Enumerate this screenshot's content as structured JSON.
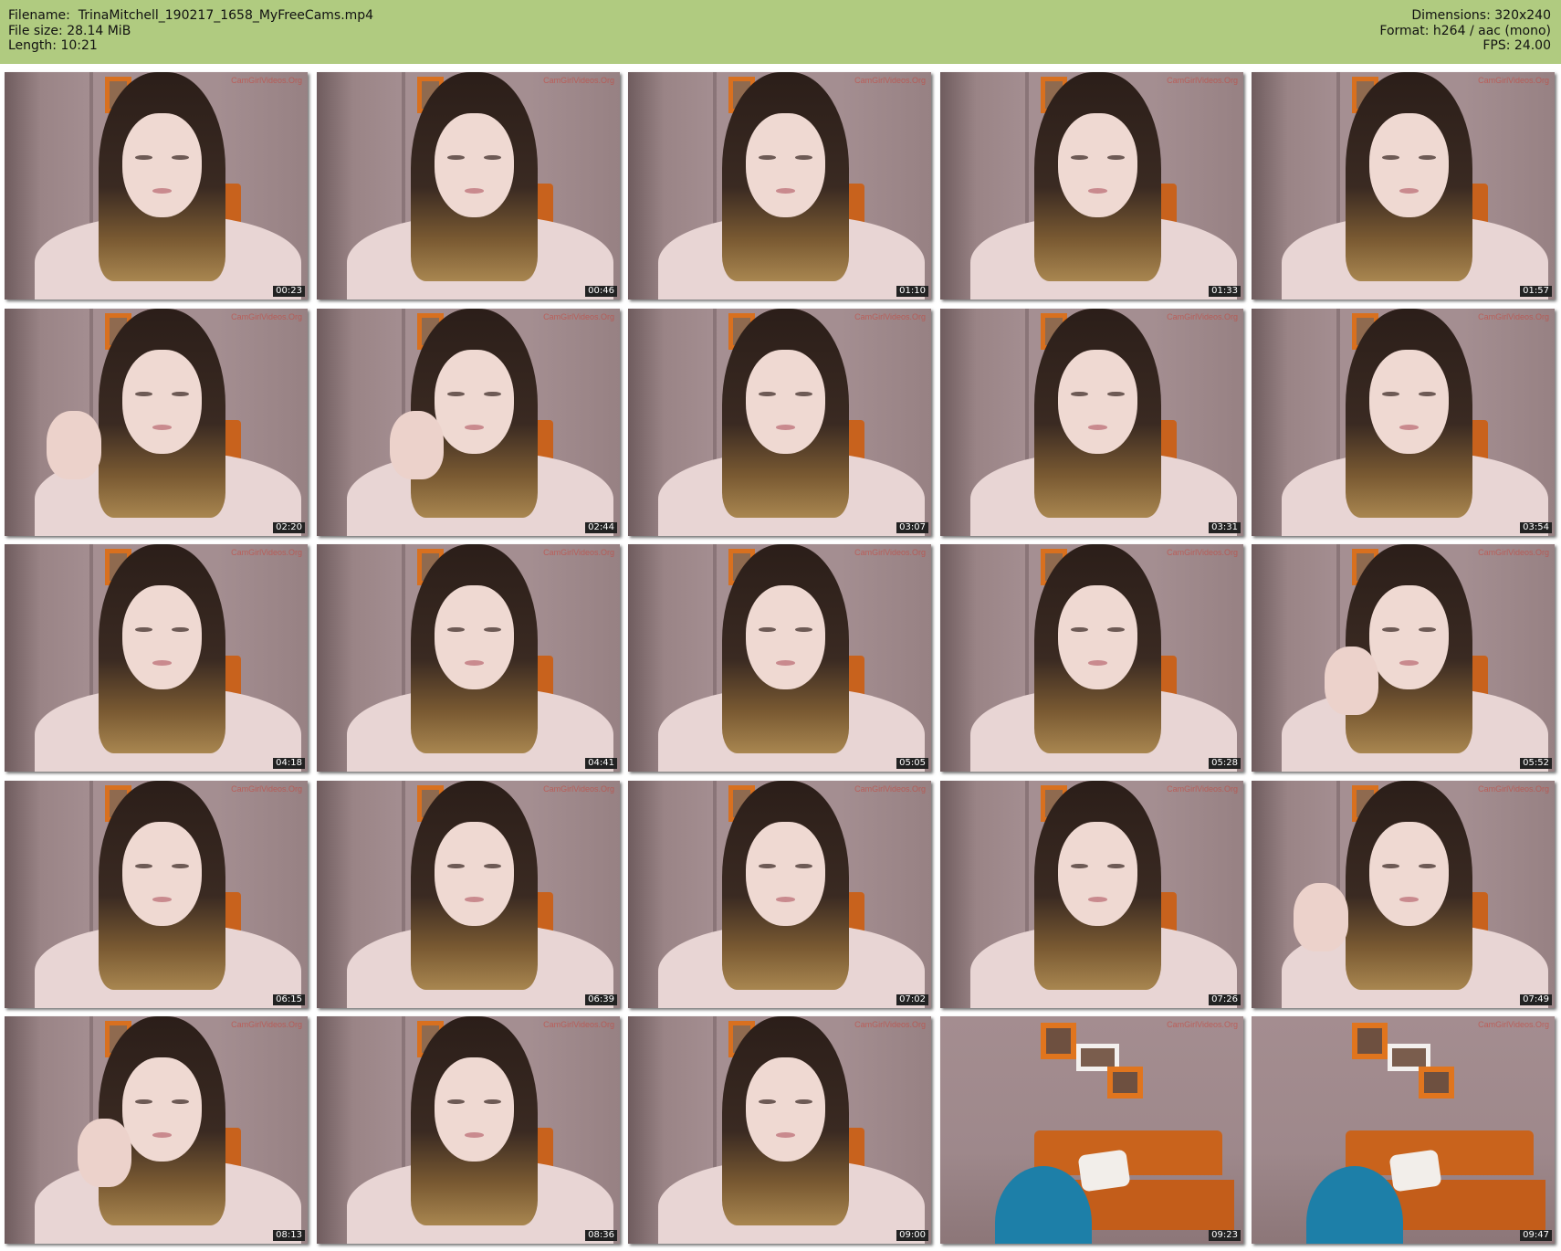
{
  "header": {
    "filename_label": "Filename:",
    "filename": "TrinaMitchell_190217_1658_MyFreeCams.mp4",
    "filesize_label": "File size:",
    "filesize": "28.14 MiB",
    "length_label": "Length:",
    "length": "10:21",
    "dimensions_label": "Dimensions:",
    "dimensions": "320x240",
    "format_label": "Format:",
    "format": "h264 / aac (mono)",
    "fps_label": "FPS:",
    "fps": "24.00",
    "background_color": "#b0cb80"
  },
  "watermark": "CamGirlVideos.Org",
  "thumbnails": [
    {
      "timestamp": "00:23",
      "scene": "face"
    },
    {
      "timestamp": "00:46",
      "scene": "face"
    },
    {
      "timestamp": "01:10",
      "scene": "face"
    },
    {
      "timestamp": "01:33",
      "scene": "face"
    },
    {
      "timestamp": "01:57",
      "scene": "face"
    },
    {
      "timestamp": "02:20",
      "scene": "face-hand"
    },
    {
      "timestamp": "02:44",
      "scene": "face-hand"
    },
    {
      "timestamp": "03:07",
      "scene": "face"
    },
    {
      "timestamp": "03:31",
      "scene": "face"
    },
    {
      "timestamp": "03:54",
      "scene": "face"
    },
    {
      "timestamp": "04:18",
      "scene": "face"
    },
    {
      "timestamp": "04:41",
      "scene": "face"
    },
    {
      "timestamp": "05:05",
      "scene": "face"
    },
    {
      "timestamp": "05:28",
      "scene": "face"
    },
    {
      "timestamp": "05:52",
      "scene": "face-hand"
    },
    {
      "timestamp": "06:15",
      "scene": "face"
    },
    {
      "timestamp": "06:39",
      "scene": "face"
    },
    {
      "timestamp": "07:02",
      "scene": "face"
    },
    {
      "timestamp": "07:26",
      "scene": "face"
    },
    {
      "timestamp": "07:49",
      "scene": "face-hand"
    },
    {
      "timestamp": "08:13",
      "scene": "face-hand"
    },
    {
      "timestamp": "08:36",
      "scene": "face"
    },
    {
      "timestamp": "09:00",
      "scene": "face"
    },
    {
      "timestamp": "09:23",
      "scene": "room"
    },
    {
      "timestamp": "09:47",
      "scene": "room"
    }
  ]
}
